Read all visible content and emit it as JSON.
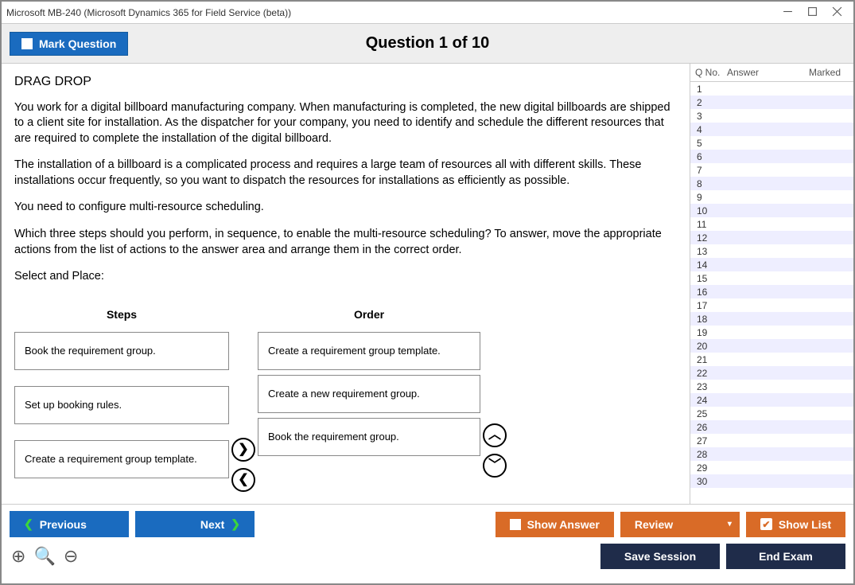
{
  "window": {
    "title": "Microsoft MB-240 (Microsoft Dynamics 365 for Field Service (beta))"
  },
  "header": {
    "mark_label": "Mark Question",
    "question_title": "Question 1 of 10"
  },
  "question": {
    "type": "DRAG DROP",
    "para1": "You work for a digital billboard manufacturing company. When manufacturing is completed, the new digital billboards are shipped to a client site for installation. As the dispatcher for your company, you need to identify and schedule the different resources that are required to complete the installation of the digital billboard.",
    "para2": "The installation of a billboard is a complicated process and requires a large team of resources all with different skills. These installations occur frequently, so you want to dispatch the resources for installations as efficiently as possible.",
    "para3": "You need to configure multi-resource scheduling.",
    "para4": "Which three steps should you perform, in sequence, to enable the multi-resource scheduling? To answer, move the appropriate actions from the list of actions to the answer area and arrange them in the correct order.",
    "select_place": "Select and Place:",
    "steps_header": "Steps",
    "order_header": "Order",
    "steps": [
      "Book the requirement group.",
      "Set up booking rules.",
      "Create a requirement group template."
    ],
    "order": [
      "Create a requirement group template.",
      "Create a new requirement group.",
      "Book the requirement group."
    ]
  },
  "sidebar": {
    "h1": "Q No.",
    "h2": "Answer",
    "h3": "Marked",
    "count": 30
  },
  "footer": {
    "previous": "Previous",
    "next": "Next",
    "show_answer": "Show Answer",
    "review": "Review",
    "show_list": "Show List",
    "save_session": "Save Session",
    "end_exam": "End Exam"
  }
}
